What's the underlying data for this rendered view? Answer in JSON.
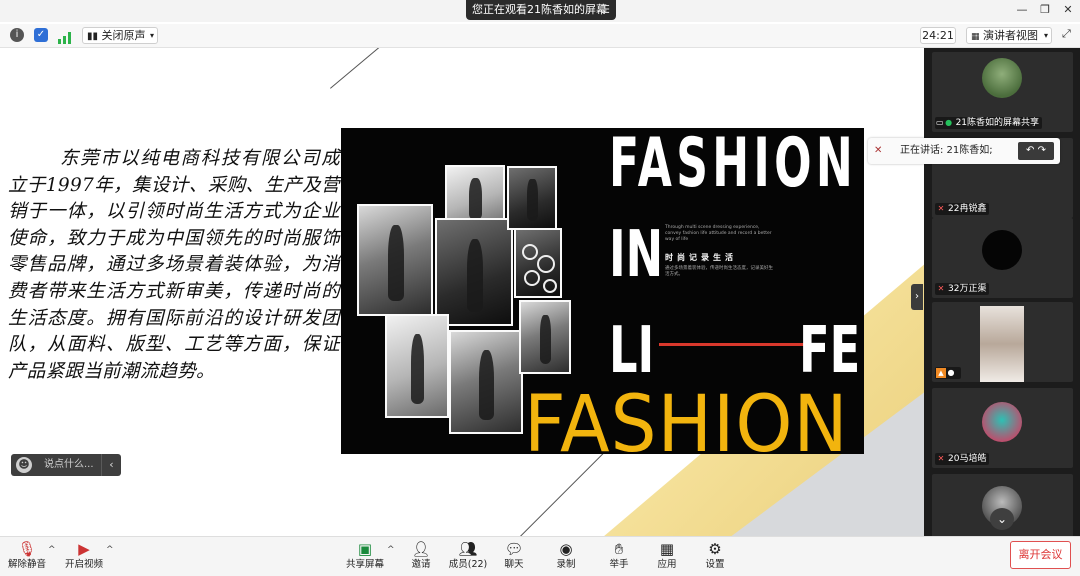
{
  "window": {
    "share_banner": "您正在观看21陈香如的屏幕",
    "banner_menu_icon": "menu-lines-icon"
  },
  "toolbar": {
    "audio_label": "关闭原声",
    "timer": "24:21",
    "view_label": "演讲者视图"
  },
  "shared_content": {
    "chinese_paragraph": "东莞市以纯电商科技有限公司成立于1997年，集设计、采购、生产及营销于一体，以引领时尚生活方式为企业使命，致力于成为中国领先的时尚服饰零售品牌，通过多场景着装体验，为消费者带来生活方式新审美，传递时尚的生活态度。拥有国际前沿的设计研发团队，从面料、版型、工艺等方面，保证产品紧跟当前潮流趋势。",
    "slide_title_line1": "FASHION",
    "slide_title_line2": "IN",
    "slide_title_li": "LI",
    "slide_title_fe": "FE",
    "slide_small_text": "Through multi scene dressing experience, convey fashion life attitude and record a better way of life",
    "slide_subtitle": "时尚记录生活",
    "slide_subtitle_small": "通过多场景着装体验，传递时尚生活态度，记录美好生活方式。",
    "big_yellow_word": "FASHION"
  },
  "chat": {
    "placeholder": "说点什么..."
  },
  "speaker": {
    "label": "正在讲话: 21陈香如;"
  },
  "gallery": {
    "participants": [
      {
        "name": "21陈香如的屏幕共享",
        "mic": "on"
      },
      {
        "name": "22冉锐鑫",
        "mic": "muted"
      },
      {
        "name": "32万正渠",
        "mic": "muted"
      },
      {
        "name": "",
        "mic": "on"
      },
      {
        "name": "20马培皓",
        "mic": "muted"
      },
      {
        "name": "",
        "mic": "muted"
      }
    ]
  },
  "bottom": {
    "unmute": "解除静音",
    "start_video": "开启视频",
    "share_screen": "共享屏幕",
    "invite": "邀请",
    "members": "成员(22)",
    "chat": "聊天",
    "record": "录制",
    "raise_hand": "举手",
    "apps": "应用",
    "settings": "设置",
    "leave": "离开会议"
  },
  "colors": {
    "accent_yellow": "#f2b40e",
    "accent_red": "#d9382c",
    "leave_red": "#d33333"
  }
}
